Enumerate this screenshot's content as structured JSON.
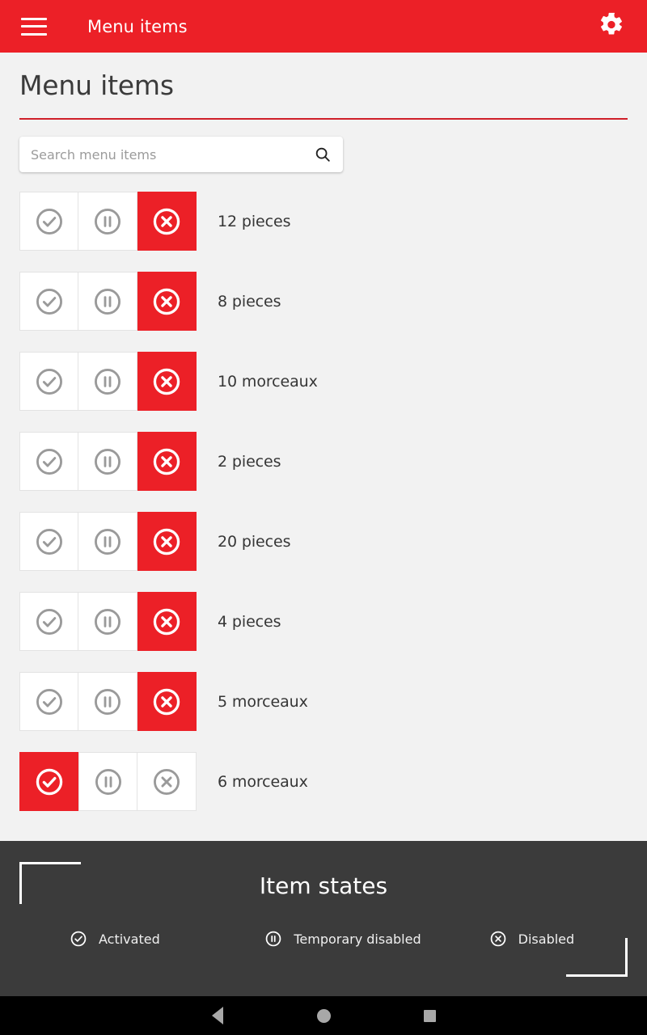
{
  "appbar": {
    "menu_icon": "hamburger-menu-icon",
    "title": "Menu items",
    "settings_icon": "gear-icon"
  },
  "page": {
    "title": "Menu items",
    "accent_color": "#ec2027",
    "rule_color": "#cf2029",
    "background_color": "#f2f2f2"
  },
  "search": {
    "placeholder": "Search menu items",
    "value": "",
    "icon": "search-icon"
  },
  "states": {
    "activated": "activated",
    "temporary_disabled": "temporary-disabled",
    "disabled": "disabled"
  },
  "list": {
    "rows": [
      {
        "label": "12 pieces",
        "selected": "disabled"
      },
      {
        "label": "8 pieces",
        "selected": "disabled"
      },
      {
        "label": "10 morceaux",
        "selected": "disabled"
      },
      {
        "label": "2 pieces",
        "selected": "disabled"
      },
      {
        "label": "20 pieces",
        "selected": "disabled"
      },
      {
        "label": "4 pieces",
        "selected": "disabled"
      },
      {
        "label": "5 morceaux",
        "selected": "disabled"
      },
      {
        "label": "6 morceaux",
        "selected": "activated"
      }
    ]
  },
  "legend": {
    "title": "Item states",
    "background_color": "#3b3b3b",
    "items": [
      {
        "icon": "check-circle-icon",
        "label": "Activated"
      },
      {
        "icon": "pause-circle-icon",
        "label": "Temporary disabled"
      },
      {
        "icon": "x-circle-icon",
        "label": "Disabled"
      }
    ]
  },
  "navbar": {
    "back": "back-triangle-icon",
    "home": "home-circle-icon",
    "recents": "recents-square-icon"
  }
}
